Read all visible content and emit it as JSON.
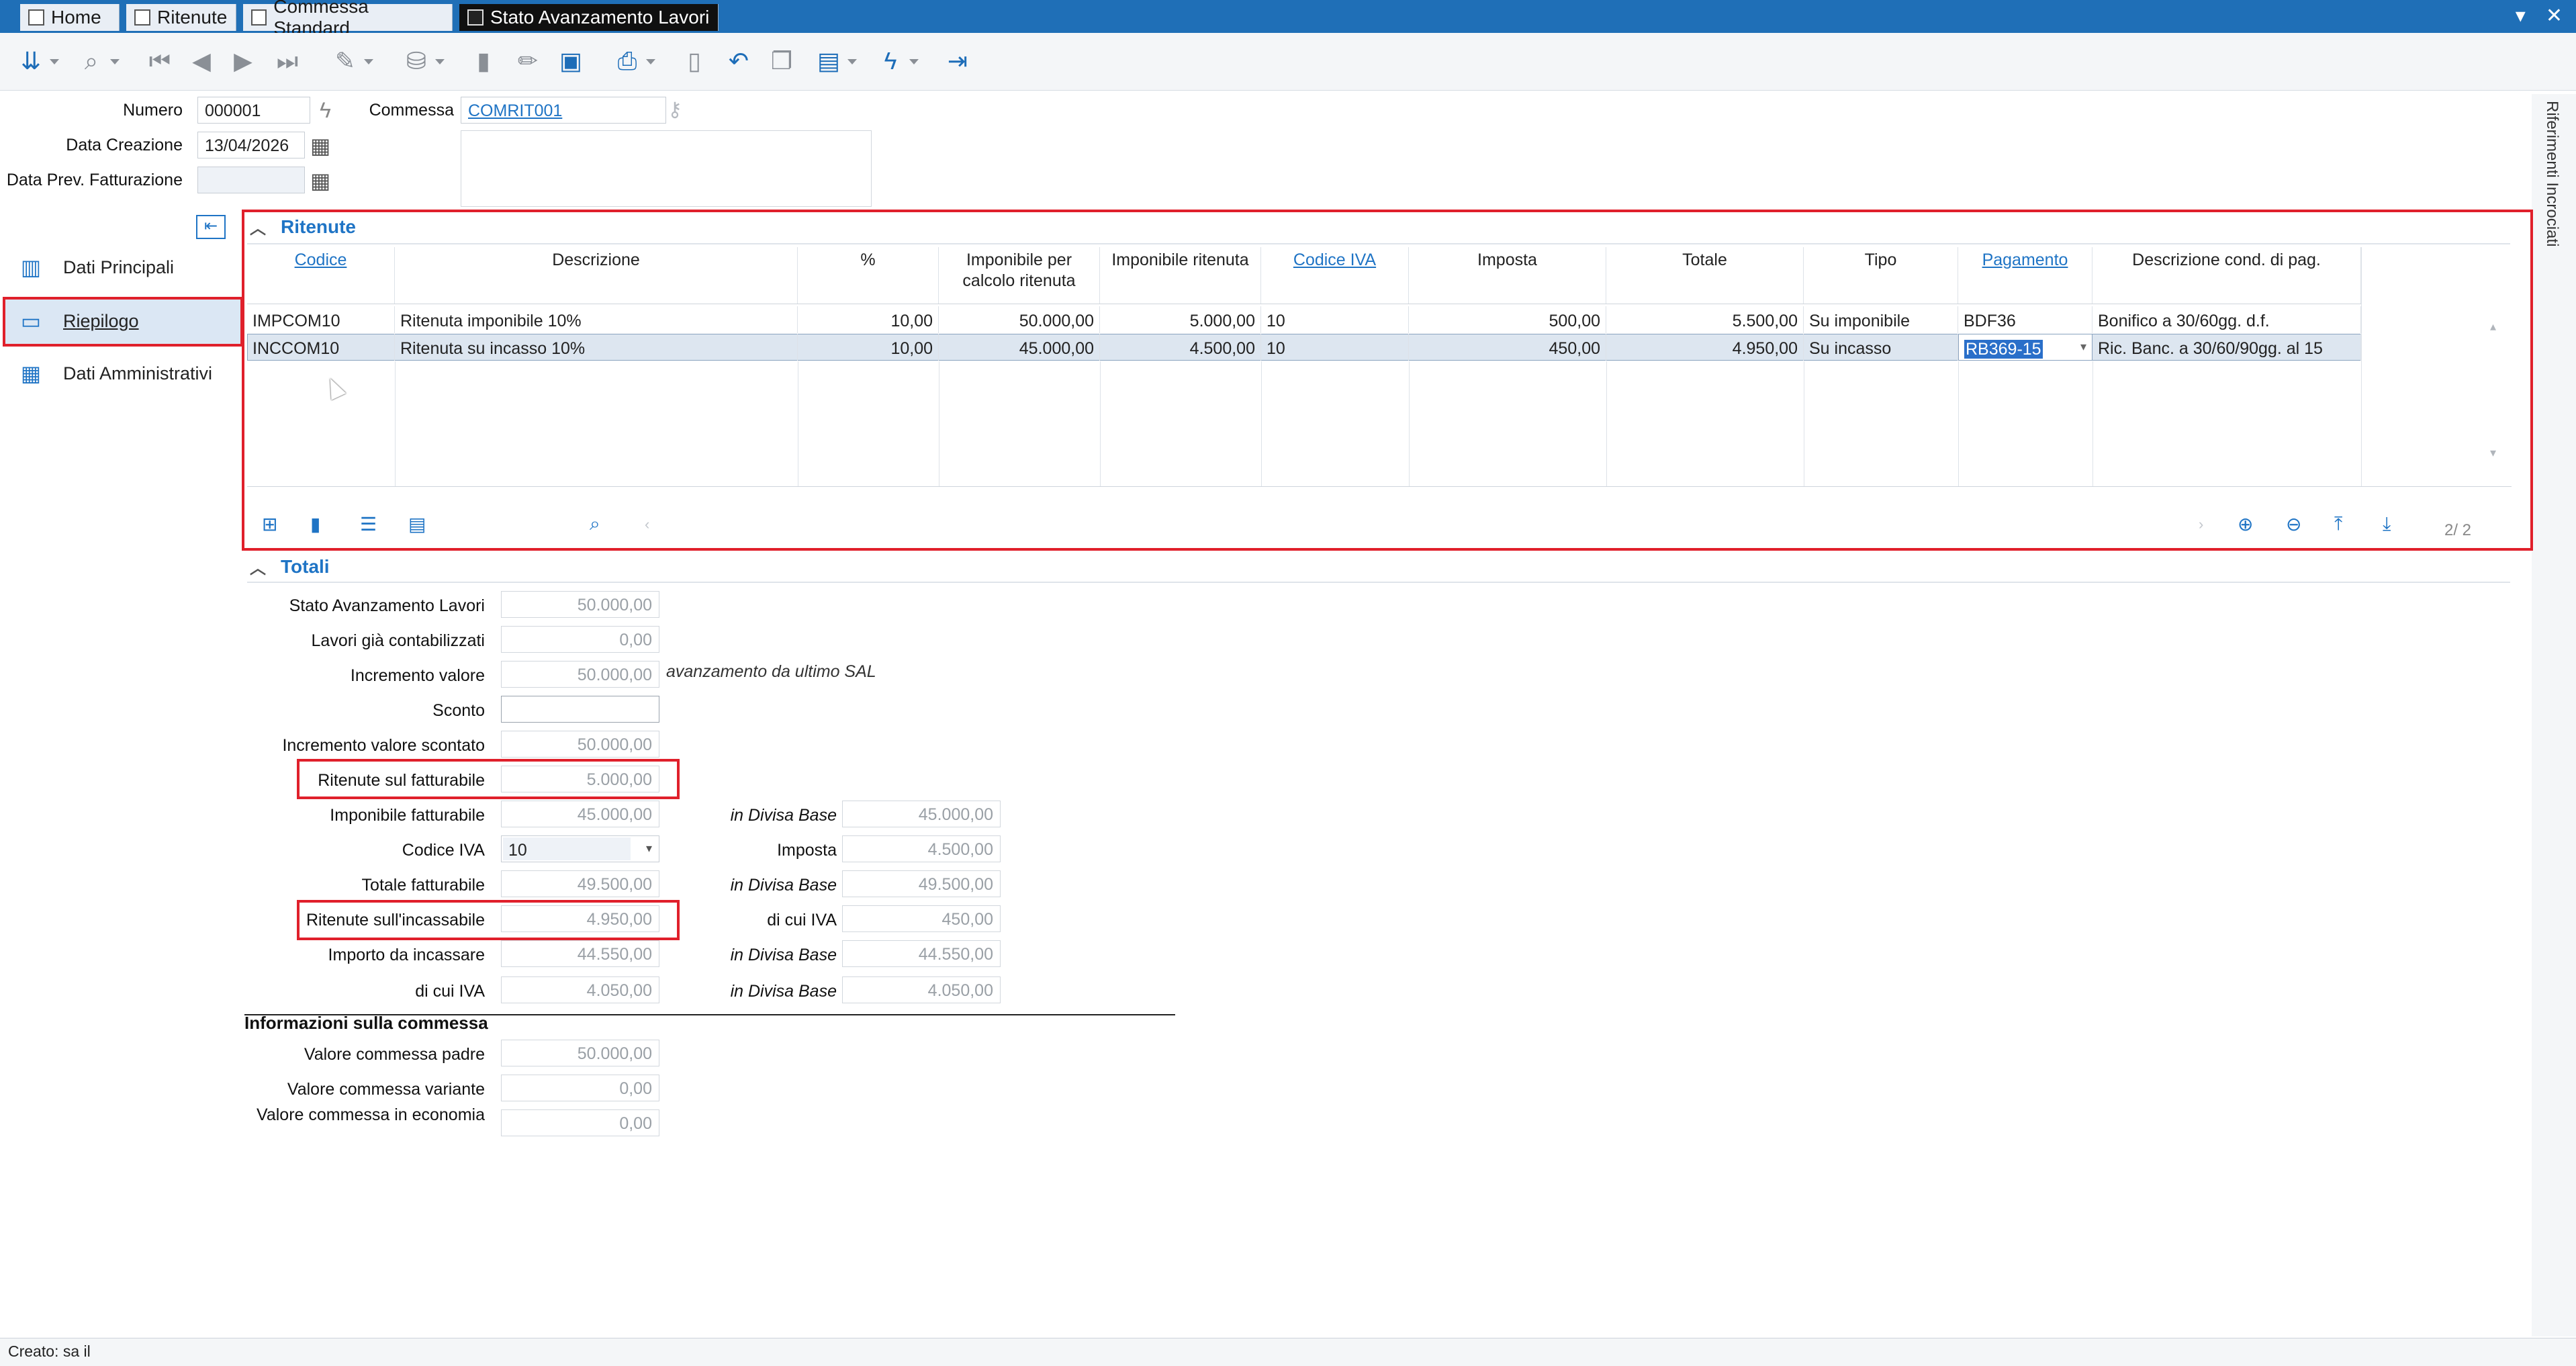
{
  "tabs": [
    {
      "label": "Home"
    },
    {
      "label": "Ritenute"
    },
    {
      "label": "Commessa Standard"
    },
    {
      "label": "Stato Avanzamento Lavori"
    }
  ],
  "window_controls": {
    "collapse": "▾",
    "close": "✕"
  },
  "toolbar_icons": [
    "collapse-all-icon",
    "search-icon",
    "first-record-icon",
    "previous-record-icon",
    "next-record-icon",
    "last-record-icon",
    "wizard-icon",
    "database-icon",
    "new-document-icon",
    "edit-icon",
    "save-icon",
    "print-icon",
    "delete-icon",
    "undo-icon",
    "copy-icon",
    "calculator-icon",
    "lightning-icon",
    "exit-icon"
  ],
  "header": {
    "numero_label": "Numero",
    "numero_value": "000001",
    "data_creazione_label": "Data Creazione",
    "data_creazione_value": "13/04/2026",
    "data_prev_label": "Data Prev. Fatturazione",
    "data_prev_value": "",
    "commessa_label": "Commessa",
    "commessa_value": "COMRIT001"
  },
  "right_sidebar": {
    "label": "Riferimenti Incrociati"
  },
  "nav": {
    "items": [
      {
        "label": "Dati Principali",
        "icon": "building-icon"
      },
      {
        "label": "Riepilogo",
        "icon": "money-icon"
      },
      {
        "label": "Dati Amministrativi",
        "icon": "bank-icon"
      }
    ]
  },
  "ritenute": {
    "title": "Ritenute",
    "columns": [
      "Codice",
      "Descrizione",
      "%",
      "Imponibile per calcolo ritenuta",
      "Imponibile ritenuta",
      "Codice IVA",
      "Imposta",
      "Totale",
      "Tipo",
      "Pagamento",
      "Descrizione cond. di pag."
    ],
    "rows": [
      [
        "IMPCOM10",
        "Ritenuta imponibile 10%",
        "10,00",
        "50.000,00",
        "5.000,00",
        "10",
        "500,00",
        "5.500,00",
        "Su imponibile",
        "BDF36",
        "Bonifico a 30/60gg. d.f."
      ],
      [
        "INCCOM10",
        "Ritenuta su incasso 10%",
        "10,00",
        "45.000,00",
        "4.500,00",
        "10",
        "450,00",
        "4.950,00",
        "Su incasso",
        "RB369-15",
        "Ric. Banc. a 30/60/90gg. al 15"
      ]
    ],
    "pager": "2/ 2"
  },
  "totali": {
    "title": "Totali",
    "stato_label": "Stato Avanzamento Lavori",
    "stato_value": "50.000,00",
    "lavori_label": "Lavori già contabilizzati",
    "lavori_value": "0,00",
    "incremento_label": "Incremento valore",
    "incremento_value": "50.000,00",
    "incremento_note": "avanzamento da ultimo SAL",
    "sconto_label": "Sconto",
    "sconto_value": "",
    "inc_scontato_label": "Incremento valore scontato",
    "inc_scontato_value": "50.000,00",
    "rit_fatt_label": "Ritenute sul fatturabile",
    "rit_fatt_value": "5.000,00",
    "imp_fatt_label": "Imponibile fatturabile",
    "imp_fatt_value": "45.000,00",
    "divisa1_label": "in Divisa Base",
    "divisa1_value": "45.000,00",
    "codice_iva_label": "Codice IVA",
    "codice_iva_value": "10",
    "imposta_label": "Imposta",
    "imposta_value": "4.500,00",
    "tot_fatt_label": "Totale fatturabile",
    "tot_fatt_value": "49.500,00",
    "divisa2_label": "in Divisa Base",
    "divisa2_value": "49.500,00",
    "rit_inc_label": "Ritenute sull'incassabile",
    "rit_inc_value": "4.950,00",
    "dicui_iva1_label": "di cui IVA",
    "dicui_iva1_value": "450,00",
    "importo_label": "Importo da incassare",
    "importo_value": "44.550,00",
    "divisa3_label": "in Divisa Base",
    "divisa3_value": "44.550,00",
    "dicui_iva2_label": "di cui IVA",
    "dicui_iva2_value": "4.050,00",
    "divisa4_label": "in Divisa Base",
    "divisa4_value": "4.050,00"
  },
  "info_commessa": {
    "title": "Informazioni sulla commessa",
    "padre_label": "Valore commessa padre",
    "padre_value": "50.000,00",
    "variante_label": "Valore commessa variante",
    "variante_value": "0,00",
    "economia_label": "Valore commessa in economia",
    "economia_value": "0,00"
  },
  "status": {
    "text": "Creato: sa il"
  }
}
